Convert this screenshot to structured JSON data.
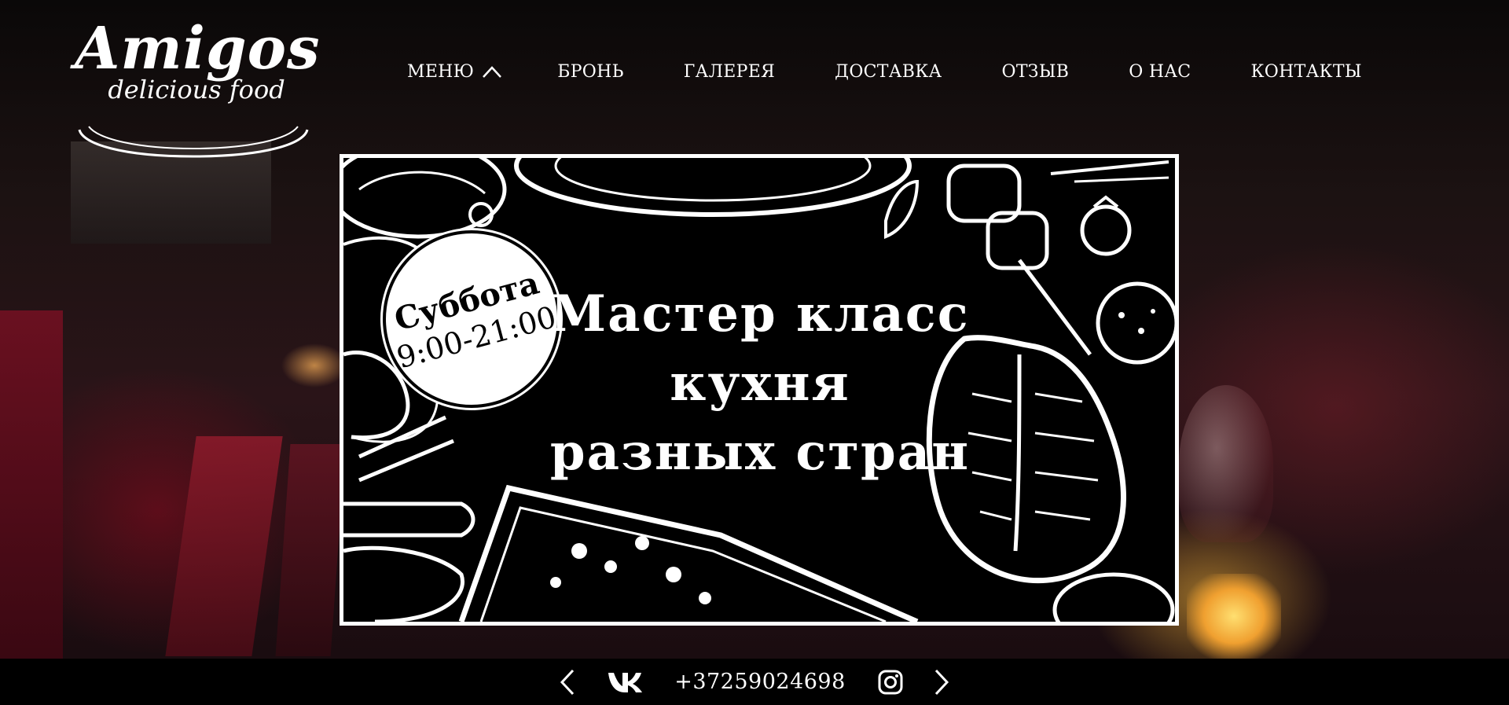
{
  "brand": {
    "name": "Amigos",
    "tagline": "delicious food"
  },
  "nav": {
    "items": [
      {
        "label": "МЕНЮ",
        "has_dropdown": true
      },
      {
        "label": "БРОНЬ"
      },
      {
        "label": "ГАЛЕРЕЯ"
      },
      {
        "label": "ДОСТАВКА"
      },
      {
        "label": "ОТЗЫВ"
      },
      {
        "label": "О НАС"
      },
      {
        "label": "КОНТАКТЫ"
      }
    ]
  },
  "banner": {
    "badge_day": "Суббота",
    "badge_time": "9:00-21:00",
    "headline_line1": "Мастер класс",
    "headline_line2": "кухня",
    "headline_line3": "разных стран"
  },
  "footer": {
    "phone": "+37259024698",
    "prev_icon": "chevron-left-icon",
    "next_icon": "chevron-right-icon",
    "social": [
      "vk-icon",
      "instagram-icon"
    ]
  },
  "colors": {
    "text": "#ffffff",
    "footer_bg": "#000000",
    "banner_border": "#ffffff"
  }
}
